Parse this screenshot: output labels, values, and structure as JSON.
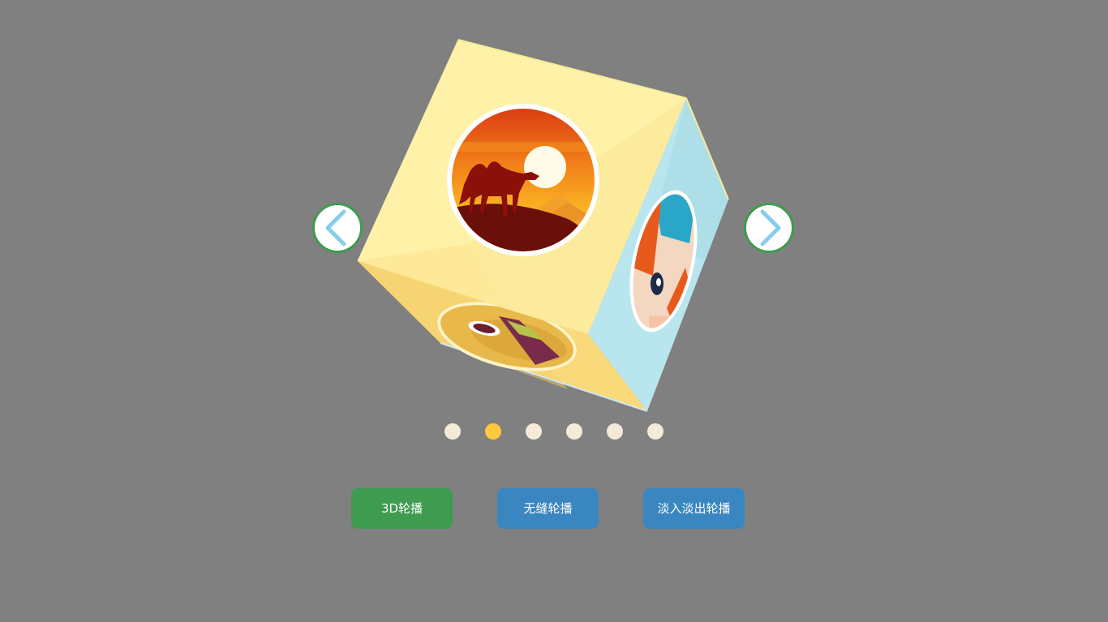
{
  "carousel": {
    "prev_icon": "chevron-left-icon",
    "next_icon": "chevron-right-icon",
    "arrow_border_color": "#3e9b4f",
    "arrow_icon_color": "#87ceeb",
    "faces": [
      {
        "face": "front",
        "image": "camel-desert-sunset",
        "color": "#fff2a8"
      },
      {
        "face": "right",
        "image": "anime-character-portrait",
        "color": "#b9e6ee"
      },
      {
        "face": "bottom",
        "image": "food-plate",
        "color": "#f9d97a"
      }
    ]
  },
  "pagination": {
    "count": 6,
    "active_index": 1,
    "active_color": "#ffc83d",
    "inactive_color": "#f5ead8"
  },
  "modes": {
    "items": [
      {
        "label": "3D轮播",
        "color": "#3e9b4f",
        "active": true
      },
      {
        "label": "无缝轮播",
        "color": "#3a86c0",
        "active": false
      },
      {
        "label": "淡入淡出轮播",
        "color": "#3a86c0",
        "active": false
      }
    ]
  }
}
